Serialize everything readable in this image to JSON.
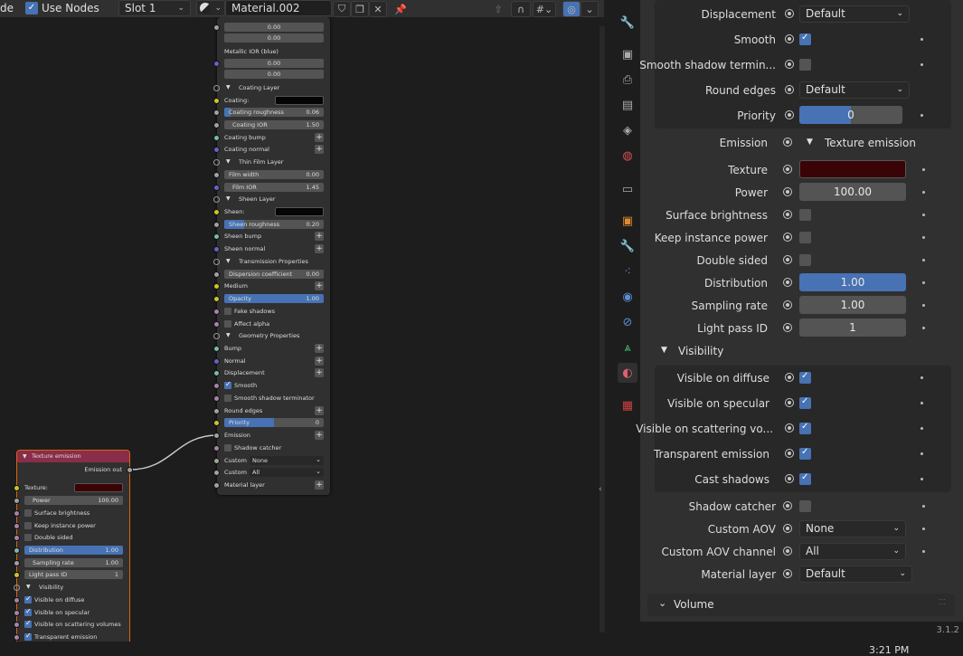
{
  "header": {
    "mode_fragment": "de",
    "use_nodes_label": "Use Nodes",
    "slot": "Slot 1",
    "material_name": "Material.002"
  },
  "principled_node": {
    "val_0_00": "0.00",
    "metallic_ior_blue": "Metallic IOR (blue)",
    "coating_layer": "Coating Layer",
    "coating": "Coating:",
    "coating_roughness": "Coating roughness",
    "coating_roughness_val": "0.06",
    "coating_ior": "Coating IOR",
    "coating_ior_val": "1.50",
    "coating_bump": "Coating bump",
    "coating_normal": "Coating normal",
    "thin_film_layer": "Thin Film Layer",
    "film_width": "Film width",
    "film_width_val": "0.00",
    "film_ior": "Film IOR",
    "film_ior_val": "1.45",
    "sheen_layer": "Sheen Layer",
    "sheen": "Sheen:",
    "sheen_roughness": "Sheen roughness",
    "sheen_roughness_val": "0.20",
    "sheen_bump": "Sheen bump",
    "sheen_normal": "Sheen normal",
    "transmission_properties": "Transmission Properties",
    "dispersion_coefficient": "Dispersion coefficient",
    "dispersion_val": "0.00",
    "medium": "Medium",
    "opacity": "Opacity",
    "opacity_val": "1.00",
    "fake_shadows": "Fake shadows",
    "affect_alpha": "Affect alpha",
    "geometry_properties": "Geometry Properties",
    "bump": "Bump",
    "normal": "Normal",
    "displacement": "Displacement",
    "smooth": "Smooth",
    "smooth_shadow_terminator": "Smooth shadow terminator",
    "round_edges": "Round edges",
    "priority": "Priority",
    "priority_val": "0",
    "emission": "Emission",
    "shadow_catcher": "Shadow catcher",
    "custom": "Custom",
    "custom_none": "None",
    "custom_all": "All",
    "material_layer": "Material layer"
  },
  "texture_node": {
    "title": "Texture emission",
    "emission_out": "Emission out",
    "texture": "Texture:",
    "power": "Power",
    "power_val": "100.00",
    "surface_brightness": "Surface brightness",
    "keep_instance_power": "Keep instance power",
    "double_sided": "Double sided",
    "distribution": "Distribution",
    "distribution_val": "1.00",
    "sampling_rate": "Sampling rate",
    "sampling_rate_val": "1.00",
    "light_pass_id": "Light pass ID",
    "light_pass_id_val": "1",
    "visibility": "Visibility",
    "visible_on_diffuse": "Visible on diffuse",
    "visible_on_specular": "Visible on specular",
    "visible_on_scattering_volumes": "Visible on scattering volumes",
    "transparent_emission": "Transparent emission"
  },
  "properties": {
    "displacement": "Displacement",
    "displacement_val": "Default",
    "smooth": "Smooth",
    "smooth_shadow_term": "Smooth shadow termin...",
    "round_edges": "Round edges",
    "round_edges_val": "Default",
    "priority": "Priority",
    "priority_val": "0",
    "emission": "Emission",
    "texture_emission": "Texture emission",
    "texture": "Texture",
    "power": "Power",
    "power_val": "100.00",
    "surface_brightness": "Surface brightness",
    "keep_instance_power": "Keep instance power",
    "double_sided": "Double sided",
    "distribution": "Distribution",
    "distribution_val": "1.00",
    "sampling_rate": "Sampling rate",
    "sampling_rate_val": "1.00",
    "light_pass_id": "Light pass ID",
    "light_pass_id_val": "1",
    "visibility": "Visibility",
    "visible_on_diffuse": "Visible on diffuse",
    "visible_on_specular": "Visible on specular",
    "visible_on_scattering": "Visible on scattering vo...",
    "transparent_emission": "Transparent emission",
    "cast_shadows": "Cast shadows",
    "shadow_catcher": "Shadow catcher",
    "custom_aov": "Custom AOV",
    "custom_aov_val": "None",
    "custom_aov_channel": "Custom AOV channel",
    "custom_aov_channel_val": "All",
    "material_layer": "Material layer",
    "material_layer_val": "Default",
    "volume": "Volume"
  },
  "status": {
    "version": "3.1.2",
    "clock": "3:21 PM"
  },
  "colors": {
    "accent_blue": "#4772b3",
    "texture_swatch": "#3a0306",
    "node_header_texture": "#8a2d49",
    "selected_outline": "#e06010"
  }
}
